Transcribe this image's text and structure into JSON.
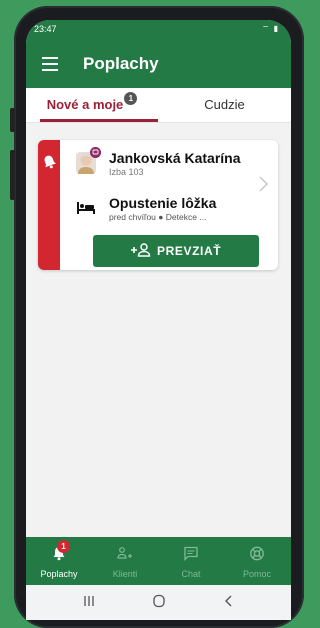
{
  "status_bar": {
    "time": "23:47",
    "icons_text": "⌔ ▮"
  },
  "app_bar": {
    "title": "Poplachy"
  },
  "tabs": [
    {
      "label": "Nové a moje",
      "badge": "1"
    },
    {
      "label": "Cudzie"
    }
  ],
  "alarm_card": {
    "person_name": "Jankovská Katarína",
    "room": "Izba 103",
    "alarm_type": "Opustenie lôžka",
    "time_ago": "pred chvíľou",
    "source": "Detekce ...",
    "take_button_label": "PREVZIAŤ"
  },
  "bottom_nav": [
    {
      "label": "Poplachy",
      "badge": "1",
      "active": true
    },
    {
      "label": "Klienti",
      "active": false
    },
    {
      "label": "Chat",
      "active": false
    },
    {
      "label": "Pomoc",
      "active": false
    }
  ],
  "colors": {
    "primary": "#237a44",
    "accent": "#9b2038",
    "alarm": "#d22630"
  }
}
